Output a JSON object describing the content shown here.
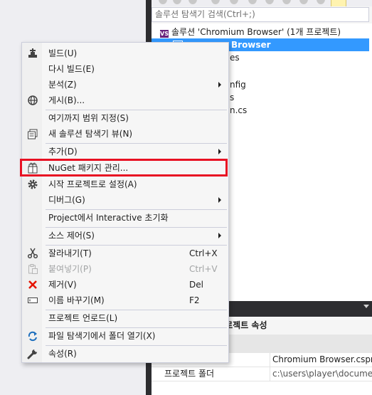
{
  "solution_explorer": {
    "search_placeholder": "솔루션 탐색기 검색(Ctrl+;)",
    "solution_item": "솔루션 'Chromium Browser' (1개 프로젝트)",
    "project_item_fragment": "Browser",
    "visible_fragments": [
      "es",
      "nfig",
      "s",
      "n.cs"
    ]
  },
  "properties": {
    "title_fragment": "r 프로젝트 속성",
    "rows": [
      {
        "name": "",
        "value": "Chromium Browser.csproj"
      },
      {
        "name": "프로젝트 폴더",
        "value": "c:\\users\\player\\docume"
      }
    ]
  },
  "context_menu": {
    "items": [
      {
        "label": "빌드(U)",
        "icon": "build-icon"
      },
      {
        "label": "다시 빌드(E)"
      },
      {
        "label": "분석(Z)",
        "submenu": true
      },
      {
        "label": "게시(B)...",
        "icon": "publish-globe-icon"
      },
      {
        "label": "여기까지 범위 지정(S)"
      },
      {
        "label": "새 솔루션 탐색기 뷰(N)",
        "icon": "new-view-icon"
      },
      {
        "label": "추가(D)",
        "submenu": true
      },
      {
        "label": "NuGet 패키지 관리...",
        "icon": "nuget-package-icon",
        "highlighted": true
      },
      {
        "label": "시작 프로젝트로 설정(A)",
        "icon": "gear-icon"
      },
      {
        "label": "디버그(G)",
        "submenu": true
      },
      {
        "label": "Project에서 Interactive 초기화"
      },
      {
        "label": "소스 제어(S)",
        "submenu": true
      },
      {
        "label": "잘라내기(T)",
        "shortcut": "Ctrl+X",
        "icon": "scissors-icon"
      },
      {
        "label": "붙여넣기(P)",
        "shortcut": "Ctrl+V",
        "icon": "paste-icon",
        "disabled": true
      },
      {
        "label": "제거(V)",
        "shortcut": "Del",
        "icon": "delete-x-icon"
      },
      {
        "label": "이름 바꾸기(M)",
        "shortcut": "F2",
        "icon": "rename-icon"
      },
      {
        "label": "프로젝트 언로드(L)"
      },
      {
        "label": "파일 탐색기에서 폴더 열기(X)",
        "icon": "open-folder-arrow-icon"
      },
      {
        "label": "속성(R)",
        "icon": "wrench-icon"
      }
    ]
  },
  "colors": {
    "highlight_border": "#e81123",
    "selection": "#3399ff",
    "menu_background": "#f6f6f6"
  }
}
